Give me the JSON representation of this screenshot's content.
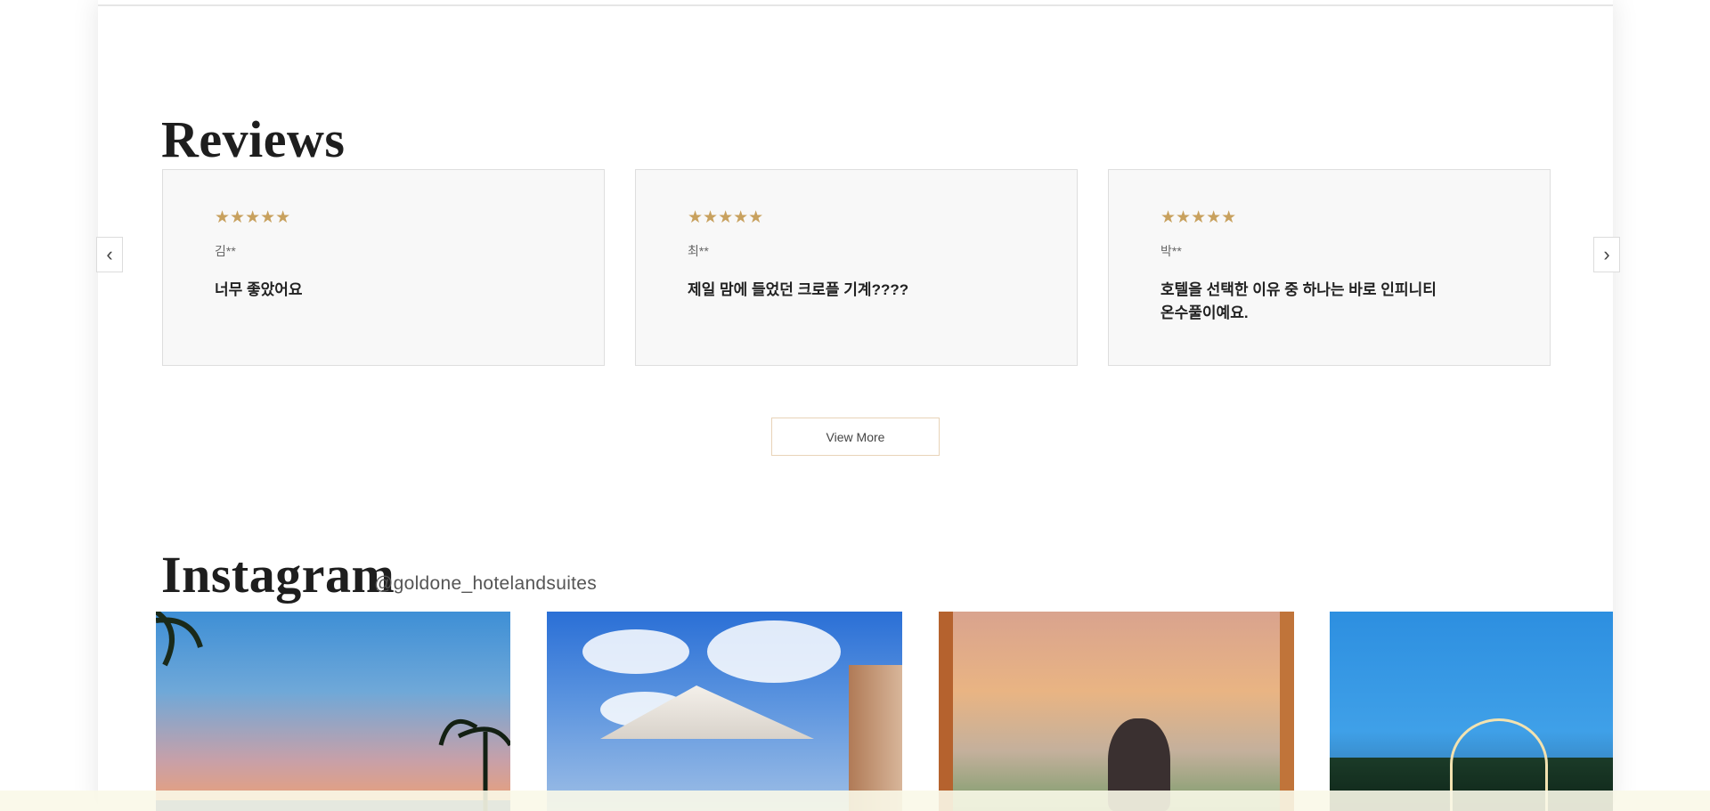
{
  "reviews": {
    "title": "Reviews",
    "items": [
      {
        "stars": "★★★★★",
        "author": "김**",
        "text": "너무 좋았어요"
      },
      {
        "stars": "★★★★★",
        "author": "최**",
        "text": "제일 맘에 들었던 크로플 기계????"
      },
      {
        "stars": "★★★★★",
        "author": "박**",
        "text": "호텔을 선택한 이유 중 하나는 바로 인피니티 온수풀이예요."
      }
    ],
    "prev_icon": "‹",
    "next_icon": "›",
    "view_more_label": "View More"
  },
  "instagram": {
    "title": "Instagram",
    "handle": "@goldone_hotelandsuites"
  },
  "colors": {
    "star": "#c8a15e",
    "button_border": "#e8d3b8",
    "card_bg": "#f8f8f8"
  }
}
